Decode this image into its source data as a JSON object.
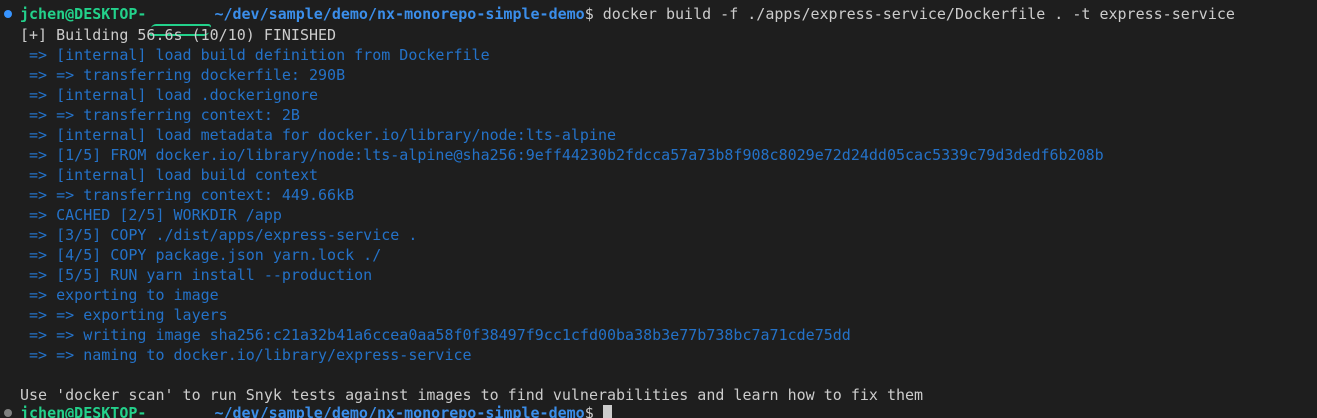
{
  "terminal": {
    "top_clipped_text": "",
    "prompt": {
      "user_host": "jchen@DESKTOP-",
      "path": "~/dev/sample/demo/nx-monorepo-simple-demo",
      "symbol": "$"
    },
    "command": " docker build -f ./apps/express-service/Dockerfile . -t express-service",
    "output_lines": [
      "[+] Building 56.6s (10/10) FINISHED",
      " => [internal] load build definition from Dockerfile",
      " => => transferring dockerfile: 290B",
      " => [internal] load .dockerignore",
      " => => transferring context: 2B",
      " => [internal] load metadata for docker.io/library/node:lts-alpine",
      " => [1/5] FROM docker.io/library/node:lts-alpine@sha256:9eff44230b2fdcca57a73b8f908c8029e72d24dd05cac5339c79d3dedf6b208b",
      " => [internal] load build context",
      " => => transferring context: 449.66kB",
      " => CACHED [2/5] WORKDIR /app",
      " => [3/5] COPY ./dist/apps/express-service .",
      " => [4/5] COPY package.json yarn.lock ./",
      " => [5/5] RUN yarn install --production",
      " => exporting to image",
      " => => exporting layers",
      " => => writing image sha256:c21a32b41a6ccea0aa58f0f38497f9cc1cfd00ba38b3e77b738bc7a71cde75dd",
      " => => naming to docker.io/library/express-service"
    ],
    "footer_message": "Use 'docker scan' to run Snyk tests against images to find vulnerabilities and learn how to fix them",
    "second_prompt": {
      "user_host": "jchen@DESKTOP-",
      "path": "~/dev/sample/demo/nx-monorepo-simple-demo",
      "symbol": "$"
    }
  },
  "colors": {
    "background": "#1e1e1e",
    "text": "#cccccc",
    "user_host": "#23d18b",
    "path": "#3b8eea",
    "step": "#2472c8",
    "status_dot": "#3794ff"
  }
}
